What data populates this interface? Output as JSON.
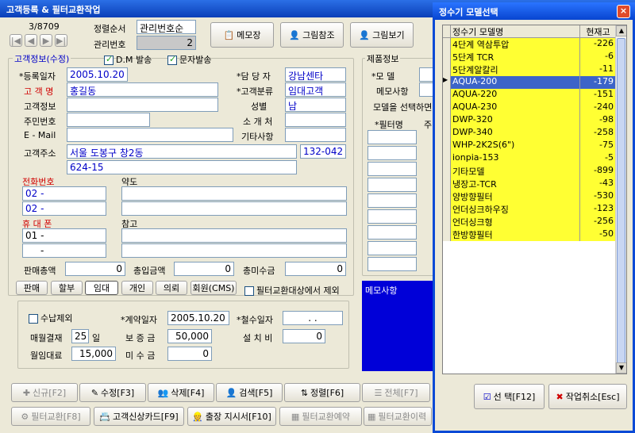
{
  "window_title": "고객등록 & 필터교환작업",
  "record_counter": "3/8709",
  "sort_label": "정렬순서",
  "sort_value": "관리번호순",
  "mgmt_label": "관리번호",
  "mgmt_value": "2",
  "top_buttons": [
    "메모장",
    "그림참조",
    "그림보기"
  ],
  "customer_section": "고객정보(수정)",
  "dm_label": "D.M 발송",
  "sms_label": "문자발송",
  "fields": {
    "reg_date_label": "*등록일자",
    "reg_date": "2005.10.20",
    "name_label": "고 객 명",
    "name": "홍길동",
    "info_label": "고객정보",
    "rrn_label": "주민번호",
    "email_label": "E - Mail",
    "addr_label": "고객주소",
    "addr1": "서울 도봉구 창2동",
    "zip": "132-042",
    "addr2": "624-15",
    "manager_label": "*담 당 자",
    "manager": "강남센타",
    "category_label": "*고객분류",
    "category": "임대고객",
    "gender_label": "성별",
    "gender": "남",
    "referrer_label": "소 개 처",
    "etc_label": "기타사항",
    "phone_label": "전화번호",
    "phone1": "02 -",
    "phone2": "02 -",
    "map_label": "약도",
    "mobile_label": "휴 대 폰",
    "mobile1": "01 -",
    "mobile2": "-",
    "ref_label": "참고"
  },
  "totals": {
    "sales_label": "판매총액",
    "sales": "0",
    "received_label": "총입금액",
    "received": "0",
    "unpaid_label": "총미수금",
    "unpaid": "0"
  },
  "type_buttons": [
    "판매",
    "할부",
    "임대",
    "개인",
    "의뢰",
    "회원(CMS)"
  ],
  "filter_exclude_label": "필터교환대상에서 제외",
  "contract": {
    "collect_exclude_label": "수납제외",
    "contract_date_label": "*계약일자",
    "contract_date": "2005.10.20",
    "withdraw_label": "*철수일자",
    "withdraw_date": ".   .",
    "monthly_label": "매월결재",
    "monthly_day": "25",
    "day_unit": "일",
    "deposit_label": "보 증 금",
    "deposit": "50,000",
    "install_label": "설 치 비",
    "install": "0",
    "rent_label": "월임대료",
    "rent": "15,000",
    "unpaid2_label": "미 수 금",
    "unpaid2": "0"
  },
  "product_section": "제품정보",
  "product": {
    "model_label": "*모    델",
    "memo_label": "메모사항",
    "choose_label": "모델을 선택하면",
    "filter_label": "*필터명",
    "col2": "주"
  },
  "memo_box": "메모사항",
  "bottom_buttons_row1": [
    "신규[F2]",
    "수정[F3]",
    "삭제[F4]",
    "검색[F5]",
    "정렬[F6]",
    "전체[F7]"
  ],
  "bottom_buttons_row2": [
    "필터교환[F8]",
    "고객신상카드[F9]",
    "출장 지시서[F10]",
    "필터교환예약",
    "필터교환이력"
  ],
  "dialog": {
    "title": "정수기 모델선택",
    "close": "×",
    "col_name": "정수기 모델명",
    "col_qty": "현재고",
    "rows": [
      {
        "name": "4단계 역삼투압",
        "qty": "-226"
      },
      {
        "name": "5단계 TCR",
        "qty": "-6"
      },
      {
        "name": "5단계알칼리",
        "qty": "-11"
      },
      {
        "name": "AQUA-200",
        "qty": "-179"
      },
      {
        "name": "AQUA-220",
        "qty": "-151"
      },
      {
        "name": "AQUA-230",
        "qty": "-240"
      },
      {
        "name": "DWP-320",
        "qty": "-98"
      },
      {
        "name": "DWP-340",
        "qty": "-258"
      },
      {
        "name": "WHP-2K2S(6\")",
        "qty": "-75"
      },
      {
        "name": "ionpia-153",
        "qty": "-5"
      },
      {
        "name": "기타모델",
        "qty": "-899"
      },
      {
        "name": "냉장고-TCR",
        "qty": "-43"
      },
      {
        "name": "양방향필터",
        "qty": "-530"
      },
      {
        "name": "언더싱크하우징",
        "qty": "-123"
      },
      {
        "name": "언더싱크형",
        "qty": "-256"
      },
      {
        "name": "한방향필터",
        "qty": "-50"
      }
    ],
    "selected_index": 3,
    "select_button": "선 택[F12]",
    "cancel_button": "작업취소[Esc]"
  }
}
